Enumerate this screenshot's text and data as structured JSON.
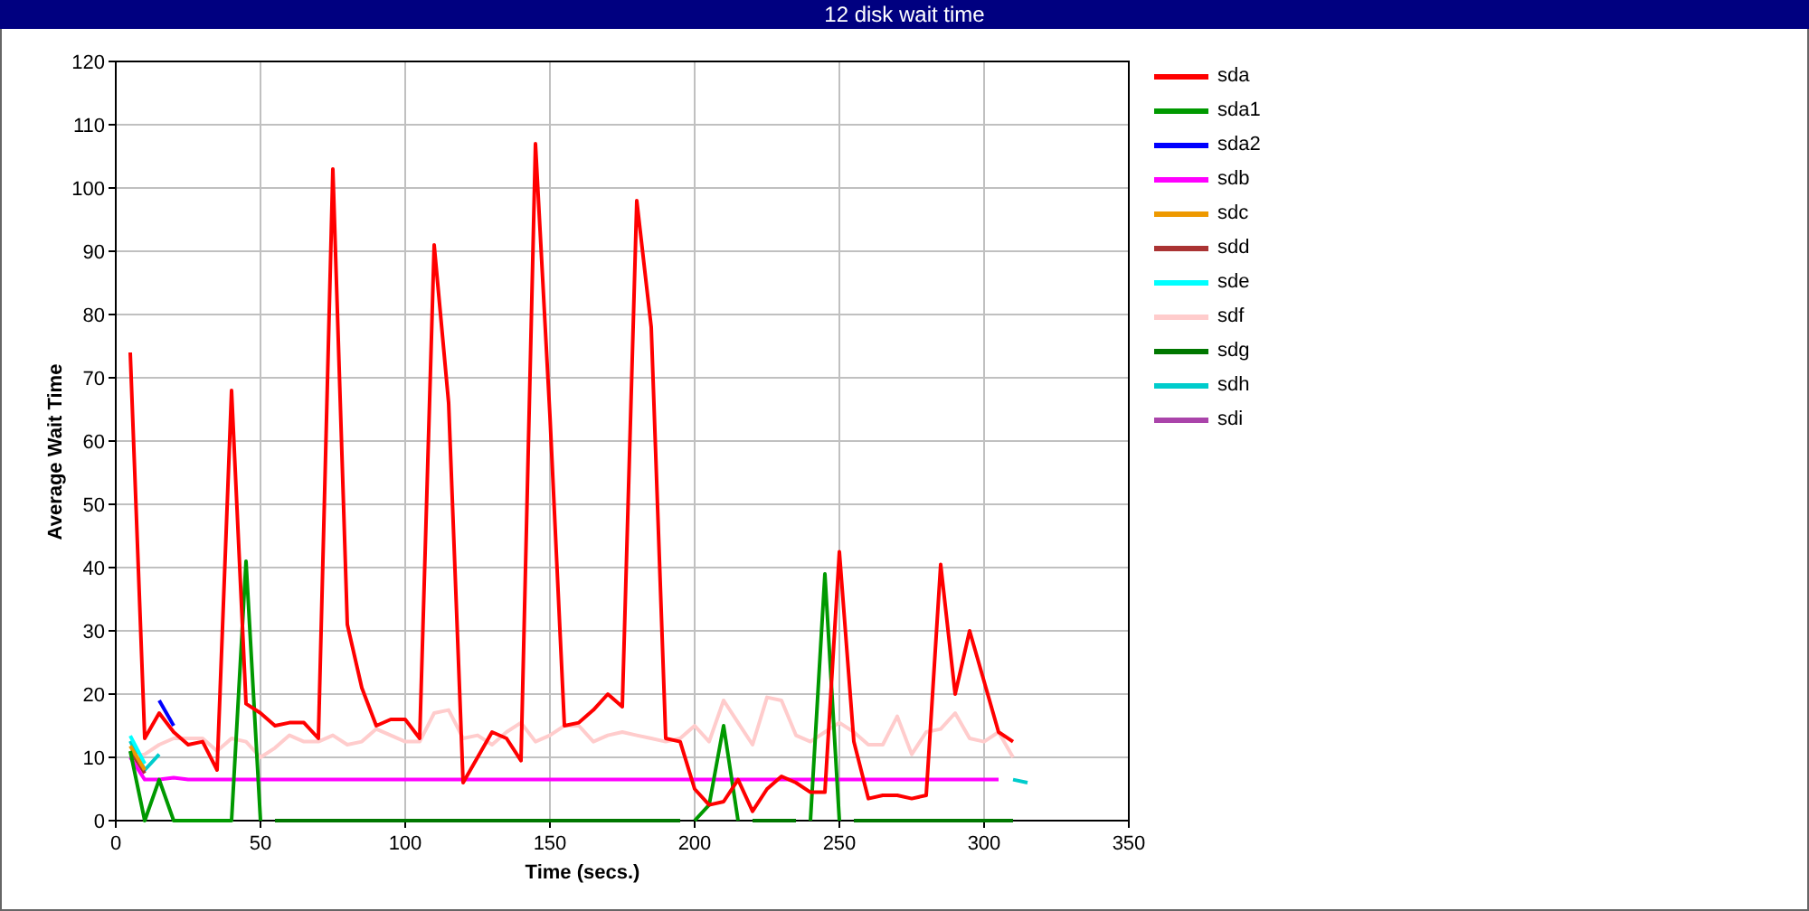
{
  "window": {
    "title": "12 disk wait time"
  },
  "chart": {
    "chart_data": {
      "type": "line",
      "xlabel": "Time (secs.)",
      "ylabel": "Average Wait Time",
      "xlim": [
        0,
        350
      ],
      "ylim": [
        0,
        120
      ],
      "xticks": [
        0,
        50,
        100,
        150,
        200,
        250,
        300,
        350
      ],
      "yticks": [
        0,
        10,
        20,
        30,
        40,
        50,
        60,
        70,
        80,
        90,
        100,
        110,
        120
      ],
      "grid": true,
      "legend": true,
      "x": [
        5,
        10,
        15,
        20,
        25,
        30,
        35,
        40,
        45,
        50,
        55,
        60,
        65,
        70,
        75,
        80,
        85,
        90,
        95,
        100,
        105,
        110,
        115,
        120,
        125,
        130,
        135,
        140,
        145,
        150,
        155,
        160,
        165,
        170,
        175,
        180,
        185,
        190,
        195,
        200,
        205,
        210,
        215,
        220,
        225,
        230,
        235,
        240,
        245,
        250,
        255,
        260,
        265,
        270,
        275,
        280,
        285,
        290,
        295,
        300,
        305,
        310,
        315
      ],
      "series": [
        {
          "name": "sda",
          "color": "#ff0000",
          "values": [
            74,
            13,
            17,
            14,
            12,
            12.5,
            8,
            68,
            18.5,
            17,
            15,
            15.5,
            15.5,
            13,
            103,
            31,
            21,
            15,
            16,
            16,
            13,
            91,
            66,
            6,
            10,
            14,
            13,
            9.5,
            107,
            64,
            15,
            15.5,
            17.5,
            20,
            18,
            98,
            78,
            13,
            12.5,
            5,
            2.5,
            3,
            6.5,
            1.5,
            5,
            7,
            6,
            4.5,
            4.5,
            42.5,
            12.5,
            3.5,
            4,
            4,
            3.5,
            4,
            40.5,
            20,
            30,
            22,
            14,
            12.5,
            null
          ]
        },
        {
          "name": "sda1",
          "color": "#009900",
          "values": [
            11,
            0,
            6.5,
            0,
            0,
            0,
            0,
            0,
            41,
            0,
            null,
            null,
            null,
            null,
            null,
            null,
            null,
            null,
            null,
            null,
            null,
            null,
            null,
            null,
            null,
            null,
            null,
            null,
            null,
            null,
            null,
            null,
            null,
            null,
            null,
            null,
            null,
            null,
            null,
            0,
            2.5,
            15,
            0,
            null,
            null,
            null,
            null,
            0,
            39,
            0,
            null,
            null,
            null,
            null,
            null,
            null,
            null,
            null,
            null,
            null,
            null,
            null,
            null
          ]
        },
        {
          "name": "sda2",
          "color": "#0000ff",
          "values": [
            null,
            null,
            19,
            15,
            null,
            null,
            null,
            null,
            null,
            null,
            null,
            null,
            null,
            null,
            null,
            null,
            null,
            null,
            null,
            null,
            null,
            null,
            null,
            null,
            null,
            null,
            null,
            null,
            null,
            null,
            null,
            null,
            null,
            null,
            null,
            null,
            null,
            null,
            null,
            null,
            null,
            null,
            null,
            null,
            null,
            null,
            null,
            null,
            null,
            null,
            null,
            null,
            null,
            null,
            null,
            null,
            null,
            null,
            null,
            null,
            null,
            null,
            null
          ]
        },
        {
          "name": "sdb",
          "color": "#ff00ff",
          "values": [
            10,
            6.5,
            6.5,
            6.8,
            6.5,
            6.5,
            6.5,
            6.5,
            6.5,
            6.5,
            6.5,
            6.5,
            6.5,
            6.5,
            6.5,
            6.5,
            6.5,
            6.5,
            6.5,
            6.5,
            6.5,
            6.5,
            6.5,
            6.5,
            6.5,
            6.5,
            6.5,
            6.5,
            6.5,
            6.5,
            6.5,
            6.5,
            6.5,
            6.5,
            6.5,
            6.5,
            6.5,
            6.5,
            6.5,
            6.5,
            6.5,
            6.5,
            6.5,
            6.5,
            6.5,
            6.5,
            6.5,
            6.5,
            6.5,
            6.5,
            6.5,
            6.5,
            6.5,
            6.5,
            6.5,
            6.5,
            6.5,
            6.5,
            6.5,
            6.5,
            6.5,
            null,
            null
          ]
        },
        {
          "name": "sdc",
          "color": "#ee9900",
          "values": [
            11.8,
            8,
            null,
            null,
            null,
            null,
            null,
            null,
            null,
            null,
            null,
            null,
            null,
            null,
            null,
            null,
            null,
            null,
            null,
            null,
            null,
            null,
            null,
            null,
            null,
            null,
            null,
            null,
            null,
            null,
            null,
            null,
            null,
            null,
            null,
            null,
            null,
            null,
            null,
            null,
            null,
            null,
            null,
            null,
            null,
            null,
            null,
            null,
            null,
            null,
            null,
            null,
            null,
            null,
            null,
            null,
            null,
            null,
            null,
            null,
            null,
            null,
            null
          ]
        },
        {
          "name": "sdd",
          "color": "#aa3333",
          "values": [
            11,
            7.5,
            null,
            null,
            null,
            null,
            null,
            null,
            null,
            null,
            null,
            null,
            null,
            null,
            null,
            null,
            null,
            null,
            null,
            null,
            null,
            null,
            null,
            null,
            null,
            null,
            null,
            null,
            null,
            null,
            null,
            null,
            null,
            null,
            null,
            null,
            null,
            null,
            null,
            null,
            null,
            null,
            null,
            null,
            null,
            null,
            null,
            null,
            null,
            null,
            null,
            null,
            null,
            null,
            null,
            null,
            null,
            null,
            null,
            null,
            null,
            null,
            null
          ]
        },
        {
          "name": "sde",
          "color": "#00ffff",
          "values": [
            13.4,
            9,
            null,
            null,
            null,
            null,
            null,
            null,
            null,
            null,
            null,
            null,
            null,
            null,
            null,
            null,
            null,
            null,
            null,
            null,
            null,
            null,
            null,
            null,
            null,
            null,
            null,
            null,
            null,
            null,
            null,
            null,
            null,
            null,
            null,
            null,
            null,
            null,
            null,
            null,
            null,
            null,
            null,
            null,
            null,
            null,
            null,
            null,
            null,
            null,
            null,
            null,
            null,
            null,
            null,
            null,
            null,
            null,
            null,
            null,
            null,
            null,
            null
          ]
        },
        {
          "name": "sdf",
          "color": "#ffcccc",
          "values": [
            10,
            10.5,
            12,
            13,
            13,
            13,
            11,
            13,
            12.5,
            10,
            11.5,
            13.5,
            12.5,
            12.5,
            13.5,
            12,
            12.5,
            14.5,
            13.5,
            12.5,
            12.5,
            17,
            17.5,
            13,
            13.5,
            12,
            14,
            15.5,
            12.5,
            13.5,
            15,
            15,
            12.5,
            13.5,
            14,
            13.5,
            13,
            12.5,
            13,
            15,
            12.5,
            19,
            15.5,
            12,
            19.5,
            19,
            13.5,
            12.5,
            14,
            15.5,
            14,
            12,
            12,
            16.5,
            10.5,
            14,
            14.5,
            17,
            13,
            12.5,
            14,
            10,
            null
          ]
        },
        {
          "name": "sdg",
          "color": "#007700",
          "values": [
            null,
            null,
            null,
            null,
            null,
            null,
            null,
            null,
            null,
            null,
            0,
            0,
            0,
            0,
            0,
            0,
            0,
            0,
            0,
            0,
            0,
            0,
            0,
            0,
            0,
            0,
            0,
            0,
            0,
            0,
            0,
            0,
            0,
            0,
            0,
            0,
            0,
            0,
            0,
            null,
            null,
            null,
            null,
            0,
            0,
            0,
            0,
            null,
            null,
            null,
            0,
            0,
            0,
            0,
            0,
            0,
            0,
            0,
            0,
            0,
            0,
            0,
            null
          ]
        },
        {
          "name": "sdh",
          "color": "#00cccc",
          "values": [
            12.6,
            8,
            10.5,
            null,
            null,
            null,
            null,
            null,
            null,
            null,
            null,
            null,
            null,
            null,
            null,
            null,
            null,
            null,
            null,
            null,
            null,
            null,
            null,
            null,
            null,
            null,
            null,
            null,
            null,
            null,
            null,
            null,
            null,
            null,
            null,
            null,
            null,
            null,
            null,
            null,
            null,
            null,
            null,
            null,
            null,
            null,
            null,
            null,
            null,
            null,
            null,
            null,
            null,
            null,
            null,
            null,
            null,
            null,
            null,
            null,
            null,
            6.5,
            6
          ]
        },
        {
          "name": "sdi",
          "color": "#aa44aa",
          "values": [
            null,
            null,
            null,
            null,
            null,
            null,
            null,
            null,
            null,
            null,
            null,
            null,
            null,
            null,
            null,
            null,
            null,
            null,
            null,
            null,
            null,
            null,
            null,
            null,
            null,
            null,
            null,
            null,
            null,
            null,
            null,
            null,
            null,
            null,
            null,
            null,
            null,
            null,
            null,
            null,
            null,
            null,
            null,
            null,
            null,
            null,
            null,
            null,
            null,
            null,
            null,
            null,
            null,
            null,
            null,
            null,
            null,
            null,
            null,
            null,
            null,
            null,
            null
          ]
        }
      ]
    }
  }
}
